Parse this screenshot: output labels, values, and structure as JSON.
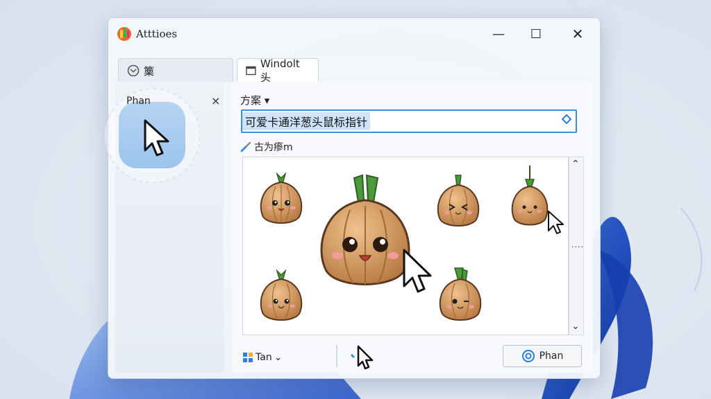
{
  "window": {
    "title": "Atttioes"
  },
  "controls": {
    "minimize": "—",
    "maximize": "☐",
    "close": "✕"
  },
  "tabs": [
    {
      "label": "篥"
    },
    {
      "label": "Windolt 头"
    }
  ],
  "sidebar": {
    "item_label": "Phan",
    "close": "×"
  },
  "scheme": {
    "label": "方案",
    "value": "可爱卡通洋葱头鼠标指针"
  },
  "preview": {
    "label": "古为瘆m"
  },
  "scroll": {
    "up": "⌃",
    "down": "⌄",
    "dots": "...."
  },
  "footer": {
    "size_label": "Tan",
    "apply_label": "Phan"
  },
  "colors": {
    "accent": "#3a8fde",
    "selection": "#cfe4fa",
    "onion": "#d39a63",
    "sprout": "#4a9a3a"
  }
}
